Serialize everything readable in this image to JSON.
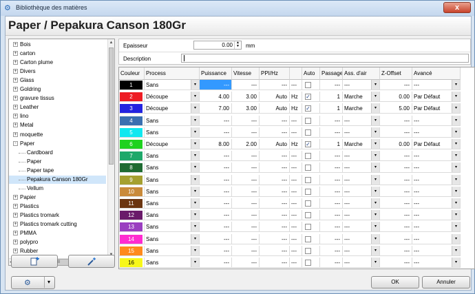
{
  "window": {
    "title": "Bibliothèque des matières",
    "close": "x"
  },
  "header": {
    "title": "Paper / Pepakura Canson 180Gr"
  },
  "tree": {
    "items": [
      {
        "label": "Bois",
        "level": 0,
        "expander": "+",
        "selected": false
      },
      {
        "label": "carton",
        "level": 0,
        "expander": "+",
        "selected": false
      },
      {
        "label": "Carton plume",
        "level": 0,
        "expander": "+",
        "selected": false
      },
      {
        "label": "Divers",
        "level": 0,
        "expander": "+",
        "selected": false
      },
      {
        "label": "Glass",
        "level": 0,
        "expander": "+",
        "selected": false
      },
      {
        "label": "Goldring",
        "level": 0,
        "expander": "+",
        "selected": false
      },
      {
        "label": "gravure tissus",
        "level": 0,
        "expander": "+",
        "selected": false
      },
      {
        "label": "Leather",
        "level": 0,
        "expander": "+",
        "selected": false
      },
      {
        "label": "lino",
        "level": 0,
        "expander": "+",
        "selected": false
      },
      {
        "label": "Metal",
        "level": 0,
        "expander": "+",
        "selected": false
      },
      {
        "label": "moquette",
        "level": 0,
        "expander": "+",
        "selected": false
      },
      {
        "label": "Paper",
        "level": 0,
        "expander": "-",
        "selected": false
      },
      {
        "label": "Cardboard",
        "level": 1,
        "expander": "",
        "selected": false
      },
      {
        "label": "Paper",
        "level": 1,
        "expander": "",
        "selected": false
      },
      {
        "label": "Paper tape",
        "level": 1,
        "expander": "",
        "selected": false
      },
      {
        "label": "Pepakura Canson 180Gr",
        "level": 1,
        "expander": "",
        "selected": true
      },
      {
        "label": "Vellum",
        "level": 1,
        "expander": "",
        "selected": false
      },
      {
        "label": "Papier",
        "level": 0,
        "expander": "+",
        "selected": false
      },
      {
        "label": "Plastics",
        "level": 0,
        "expander": "+",
        "selected": false
      },
      {
        "label": "Plastics tromark",
        "level": 0,
        "expander": "+",
        "selected": false
      },
      {
        "label": "Plastics tromark cutting",
        "level": 0,
        "expander": "+",
        "selected": false
      },
      {
        "label": "PMMA",
        "level": 0,
        "expander": "+",
        "selected": false
      },
      {
        "label": "polypro",
        "level": 0,
        "expander": "+",
        "selected": false
      },
      {
        "label": "Rubber",
        "level": 0,
        "expander": "+",
        "selected": false
      }
    ],
    "hscroll_glyph": "III"
  },
  "buttons": {
    "ok": "OK",
    "cancel": "Annuler",
    "dropdown_glyph": "▾"
  },
  "form": {
    "thickness_label": "Epaisseur",
    "thickness_value": "0.00",
    "thickness_unit": "mm",
    "description_label": "Description",
    "description_value": ""
  },
  "grid": {
    "headers": [
      "Couleur",
      "Process",
      "Puissance",
      "Vitesse",
      "PPI/Hz",
      "",
      "Auto",
      "Passage",
      "Ass. d'air",
      "Z-Offset",
      "Avancé"
    ],
    "rows": [
      {
        "n": "1",
        "color": "#000000",
        "fg": "#ffffff",
        "process": "Sans",
        "power": "---",
        "speed": "---",
        "ppi": "---",
        "unit": "---",
        "auto": false,
        "passes": "---",
        "air": "---",
        "z": "---",
        "adv": "---"
      },
      {
        "n": "2",
        "color": "#ee1c24",
        "fg": "#ffffff",
        "process": "Découpe",
        "power": "4.00",
        "speed": "3.00",
        "ppi": "Auto",
        "unit": "Hz",
        "auto": true,
        "passes": "1",
        "air": "Marche",
        "z": "0.00",
        "adv": "Par Défaut"
      },
      {
        "n": "3",
        "color": "#2323e0",
        "fg": "#ffffff",
        "process": "Découpe",
        "power": "7.00",
        "speed": "3.00",
        "ppi": "Auto",
        "unit": "Hz",
        "auto": true,
        "passes": "1",
        "air": "Marche",
        "z": "5.00",
        "adv": "Par Défaut"
      },
      {
        "n": "4",
        "color": "#3a6fb0",
        "fg": "#ffffff",
        "process": "Sans",
        "power": "---",
        "speed": "---",
        "ppi": "---",
        "unit": "---",
        "auto": false,
        "passes": "---",
        "air": "---",
        "z": "---",
        "adv": "---"
      },
      {
        "n": "5",
        "color": "#10e8f0",
        "fg": "#ffffff",
        "process": "Sans",
        "power": "---",
        "speed": "---",
        "ppi": "---",
        "unit": "---",
        "auto": false,
        "passes": "---",
        "air": "---",
        "z": "---",
        "adv": "---"
      },
      {
        "n": "6",
        "color": "#1fd21f",
        "fg": "#ffffff",
        "process": "Découpe",
        "power": "8.00",
        "speed": "2.00",
        "ppi": "Auto",
        "unit": "Hz",
        "auto": true,
        "passes": "1",
        "air": "Marche",
        "z": "0.00",
        "adv": "Par Défaut"
      },
      {
        "n": "7",
        "color": "#1ea86a",
        "fg": "#ffffff",
        "process": "Sans",
        "power": "---",
        "speed": "---",
        "ppi": "---",
        "unit": "---",
        "auto": false,
        "passes": "---",
        "air": "---",
        "z": "---",
        "adv": "---"
      },
      {
        "n": "8",
        "color": "#1f6b32",
        "fg": "#ffffff",
        "process": "Sans",
        "power": "---",
        "speed": "---",
        "ppi": "---",
        "unit": "---",
        "auto": false,
        "passes": "---",
        "air": "---",
        "z": "---",
        "adv": "---"
      },
      {
        "n": "9",
        "color": "#a5a030",
        "fg": "#ffffff",
        "process": "Sans",
        "power": "---",
        "speed": "---",
        "ppi": "---",
        "unit": "---",
        "auto": false,
        "passes": "---",
        "air": "---",
        "z": "---",
        "adv": "---"
      },
      {
        "n": "10",
        "color": "#c98a3a",
        "fg": "#ffffff",
        "process": "Sans",
        "power": "---",
        "speed": "---",
        "ppi": "---",
        "unit": "---",
        "auto": false,
        "passes": "---",
        "air": "---",
        "z": "---",
        "adv": "---"
      },
      {
        "n": "11",
        "color": "#6b3510",
        "fg": "#ffffff",
        "process": "Sans",
        "power": "---",
        "speed": "---",
        "ppi": "---",
        "unit": "---",
        "auto": false,
        "passes": "---",
        "air": "---",
        "z": "---",
        "adv": "---"
      },
      {
        "n": "12",
        "color": "#6a1a6a",
        "fg": "#ffffff",
        "process": "Sans",
        "power": "---",
        "speed": "---",
        "ppi": "---",
        "unit": "---",
        "auto": false,
        "passes": "---",
        "air": "---",
        "z": "---",
        "adv": "---"
      },
      {
        "n": "13",
        "color": "#9a3ec0",
        "fg": "#ffffff",
        "process": "Sans",
        "power": "---",
        "speed": "---",
        "ppi": "---",
        "unit": "---",
        "auto": false,
        "passes": "---",
        "air": "---",
        "z": "---",
        "adv": "---"
      },
      {
        "n": "14",
        "color": "#ff2bd0",
        "fg": "#ffffff",
        "process": "Sans",
        "power": "---",
        "speed": "---",
        "ppi": "---",
        "unit": "---",
        "auto": false,
        "passes": "---",
        "air": "---",
        "z": "---",
        "adv": "---"
      },
      {
        "n": "15",
        "color": "#ff8a1c",
        "fg": "#ffffff",
        "process": "Sans",
        "power": "---",
        "speed": "---",
        "ppi": "---",
        "unit": "---",
        "auto": false,
        "passes": "---",
        "air": "---",
        "z": "---",
        "adv": "---"
      },
      {
        "n": "16",
        "color": "#f7f71a",
        "fg": "#000000",
        "process": "Sans",
        "power": "---",
        "speed": "---",
        "ppi": "---",
        "unit": "---",
        "auto": false,
        "passes": "---",
        "air": "---",
        "z": "---",
        "adv": "---"
      }
    ]
  }
}
